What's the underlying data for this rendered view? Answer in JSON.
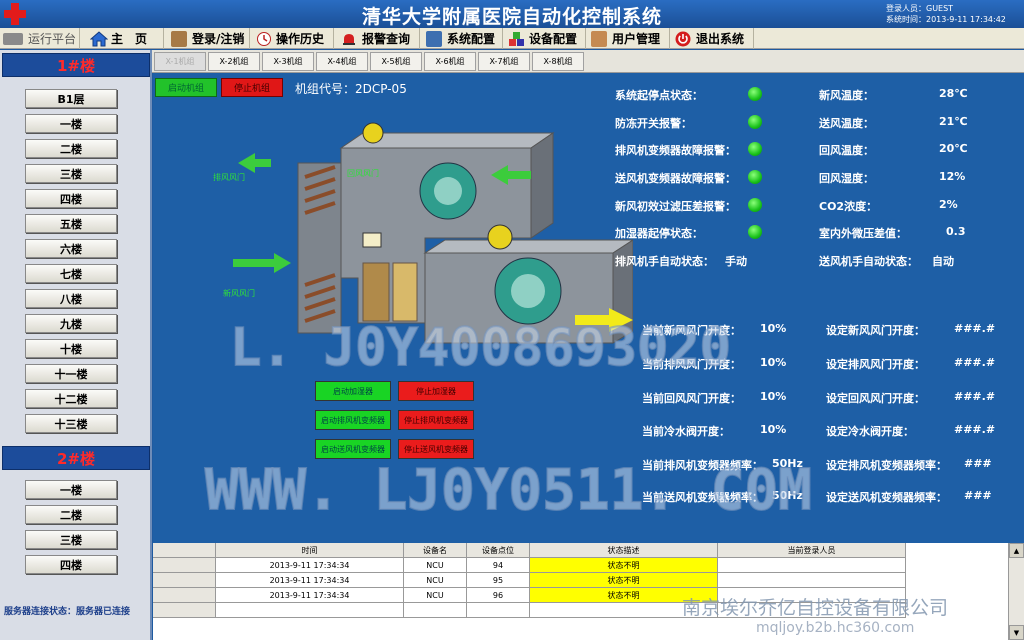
{
  "title_bar": {
    "app_title": "清华大学附属医院自动化控制系统",
    "login_user": "登录人员：GUEST",
    "system_time": "系统时间：2013-9-11  17:34:42"
  },
  "menu": {
    "items": [
      "运行平台",
      "主　页",
      "登录/注销",
      "操作历史",
      "报警查询",
      "系统配置",
      "设备配置",
      "用户管理",
      "退出系统"
    ]
  },
  "sidebar": {
    "building1": "1#楼",
    "building1_floors": [
      "B1层",
      "一楼",
      "二楼",
      "三楼",
      "四楼",
      "五楼",
      "六楼",
      "七楼",
      "八楼",
      "九楼",
      "十楼",
      "十一楼",
      "十二楼",
      "十三楼"
    ],
    "building2": "2#楼",
    "building2_floors": [
      "一楼",
      "二楼",
      "三楼",
      "四楼"
    ],
    "server_status": "服务器连接状态：服务器已连接"
  },
  "unit_tabs": [
    "X-1机组",
    "X-2机组",
    "X-3机组",
    "X-4机组",
    "X-5机组",
    "X-6机组",
    "X-7机组",
    "X-8机组"
  ],
  "unit_panel": {
    "start_unit": "启动机组",
    "stop_unit": "停止机组",
    "unit_code": "机组代号：2DCP-05",
    "diagram_labels": {
      "exhaust_damper": "排风风门",
      "return_damper": "回风风门",
      "fresh_damper": "新风风门"
    },
    "control_buttons": {
      "start_humidifier": "启动加湿器",
      "stop_humidifier": "停止加湿器",
      "start_exhaust_vfd": "启动排风机变频器",
      "stop_exhaust_vfd": "停止排风机变频器",
      "start_supply_vfd": "启动送风机变频器",
      "stop_supply_vfd": "停止送风机变频器"
    }
  },
  "status": {
    "system_start_stop": "系统起停点状态：",
    "antifreeze_alarm": "防冻开关报警：",
    "exhaust_vfd_alarm": "排风机变频器故障报警：",
    "supply_vfd_alarm": "送风机变频器故障报警：",
    "filter_alarm": "新风初效过滤压差报警：",
    "humidifier_status": "加湿器起停状态：",
    "exhaust_manual_auto_label": "排风机手自动状态：",
    "exhaust_manual_auto_value": "手动",
    "supply_manual_auto_label": "送风机手自动状态：",
    "supply_manual_auto_value": "自动"
  },
  "readings": {
    "fresh_temp_label": "新风温度：",
    "fresh_temp": "28℃",
    "supply_temp_label": "送风温度：",
    "supply_temp": "21℃",
    "return_temp_label": "回风温度：",
    "return_temp": "20℃",
    "return_humidity_label": "回风湿度：",
    "return_humidity": "12%",
    "co2_label": "CO2浓度：",
    "co2": "2%",
    "pressure_diff_label": "室内外微压差值：",
    "pressure_diff": "0.3"
  },
  "openings": {
    "cur_fresh_label": "当前新风风门开度：",
    "cur_fresh": "10%",
    "cur_exhaust_label": "当前排风风门开度：",
    "cur_exhaust": "10%",
    "cur_return_label": "当前回风风门开度：",
    "cur_return": "10%",
    "cur_chw_label": "当前冷水阀开度：",
    "cur_chw": "10%",
    "cur_exhaust_freq_label": "当前排风机变频器频率：",
    "cur_exhaust_freq": "50Hz",
    "cur_supply_freq_label": "当前送风机变频器频率：",
    "cur_supply_freq": "50Hz",
    "set_fresh_label": "设定新风风门开度：",
    "set_fresh": "###.#",
    "set_exhaust_label": "设定排风风门开度：",
    "set_exhaust": "###.#",
    "set_return_label": "设定回风风门开度：",
    "set_return": "###.#",
    "set_chw_label": "设定冷水阀开度：",
    "set_chw": "###.#",
    "set_exhaust_freq_label": "设定排风机变频器频率：",
    "set_exhaust_freq": "###",
    "set_supply_freq_label": "设定送风机变频器频率：",
    "set_supply_freq": "###"
  },
  "events": {
    "columns": [
      "时间",
      "设备名",
      "设备点位",
      "状态描述",
      "当前登录人员"
    ],
    "rows": [
      [
        "2013-9-11 17:34:34",
        "NCU",
        "94",
        "状态不明",
        ""
      ],
      [
        "2013-9-11 17:34:34",
        "NCU",
        "95",
        "状态不明",
        ""
      ],
      [
        "2013-9-11 17:34:34",
        "NCU",
        "96",
        "状态不明",
        ""
      ]
    ]
  },
  "watermark": {
    "line1": "L. J0Y4008693020",
    "line2": "WWW. LJ0Y0511. C0M",
    "company": "南京埃尔乔亿自控设备有限公司",
    "site": "mqljoy.b2b.hc360.com"
  },
  "colors": {
    "panel_bg": "#1e5fa6",
    "led_on": "#19c21a",
    "alarm_yellow": "#ffff00",
    "building_header_text": "#ff2a2a"
  }
}
